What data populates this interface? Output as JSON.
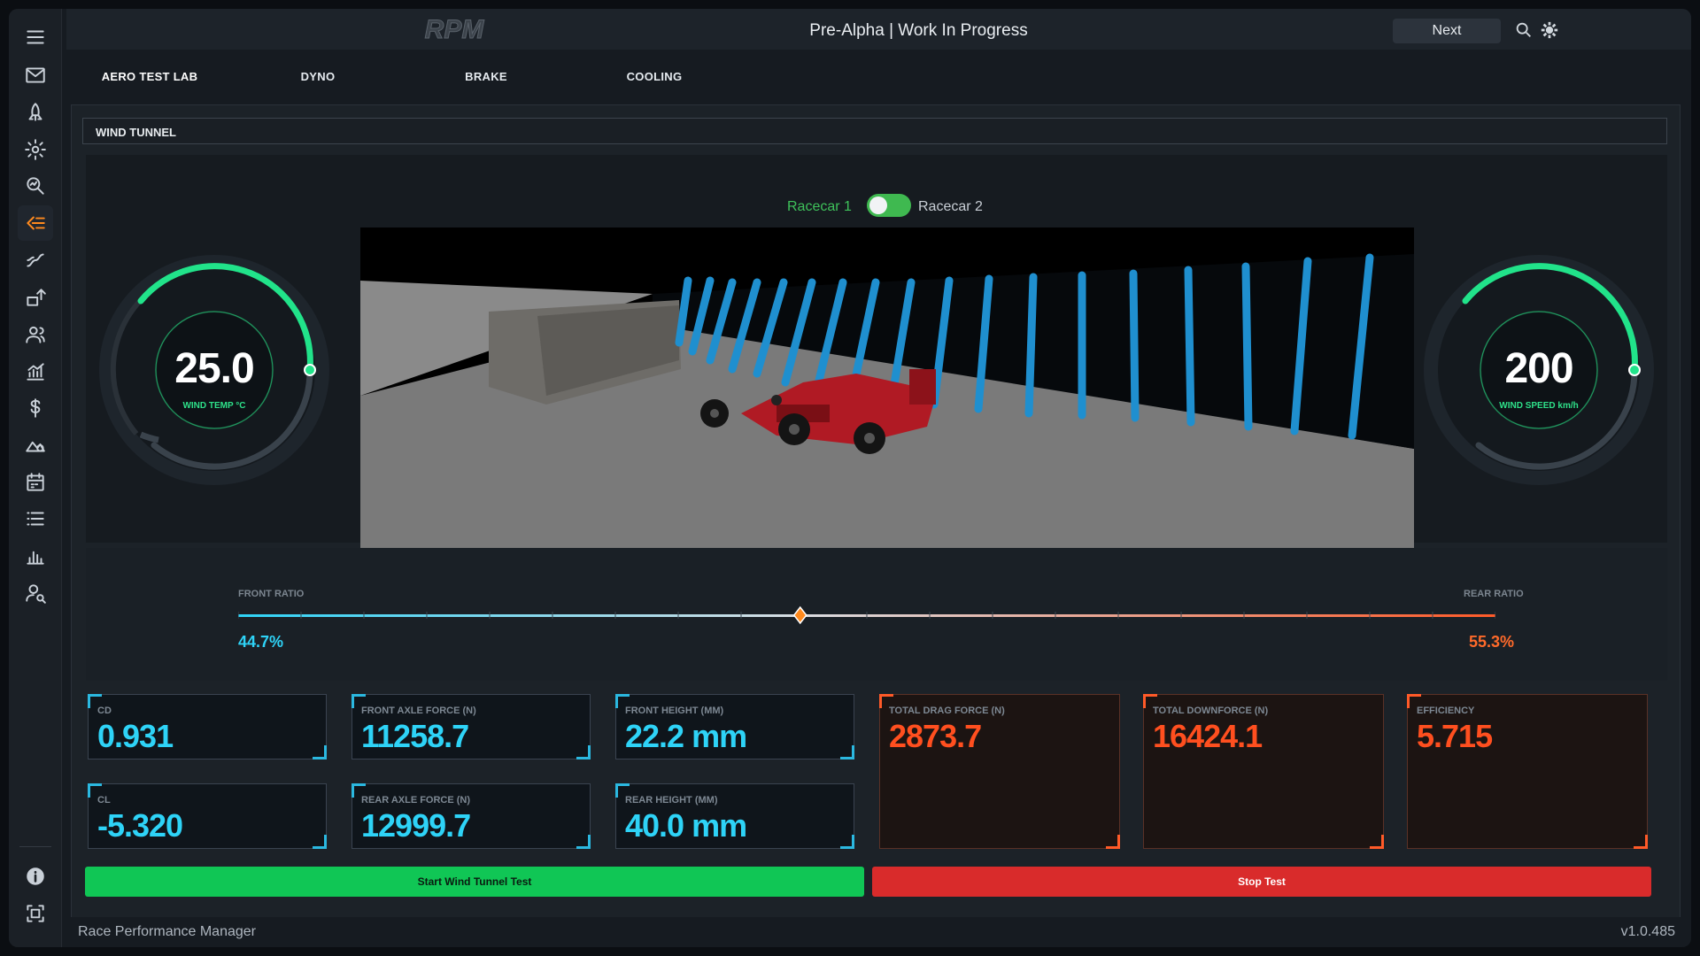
{
  "header": {
    "logo_text": "RPM",
    "title": "Pre-Alpha | Work In Progress",
    "next_label": "Next"
  },
  "sidebar": {
    "items": [
      "menu-icon",
      "mail-icon",
      "rocket-icon",
      "settings-icon",
      "search-analytics-icon",
      "aero-icon",
      "curve-icon",
      "upgrade-icon",
      "staff-icon",
      "chart-icon",
      "dollar-icon",
      "telemetry-icon",
      "calendar-icon",
      "list-icon",
      "standings-icon",
      "scout-icon"
    ],
    "bottom": [
      "info-icon",
      "scan-icon"
    ],
    "active": "aero-icon"
  },
  "tabs": [
    {
      "label": "AERO TEST LAB",
      "active": true
    },
    {
      "label": "DYNO",
      "active": false
    },
    {
      "label": "BRAKE",
      "active": false
    },
    {
      "label": "COOLING",
      "active": false
    }
  ],
  "section": {
    "title": "WIND TUNNEL"
  },
  "toggle": {
    "left_label": "Racecar 1",
    "right_label": "Racecar 2",
    "selected": "Racecar 1"
  },
  "gauges": {
    "wind_temp": {
      "value": "25.0",
      "label": "WIND TEMP °C",
      "level": 0.42
    },
    "wind_speed": {
      "value": "200",
      "label": "WIND SPEED km/h",
      "level": 0.42
    }
  },
  "ratio": {
    "front_label": "FRONT RATIO",
    "rear_label": "REAR RATIO",
    "front_value": "44.7%",
    "rear_value": "55.3%",
    "front_fraction": 0.447
  },
  "metrics": {
    "cd": {
      "label": "CD",
      "value": "0.931"
    },
    "cl": {
      "label": "CL",
      "value": "-5.320"
    },
    "front_axle": {
      "label": "FRONT AXLE FORCE (N)",
      "value": "11258.7"
    },
    "rear_axle": {
      "label": "REAR AXLE FORCE (N)",
      "value": "12999.7"
    },
    "front_height": {
      "label": "FRONT HEIGHT (MM)",
      "value": "22.2 mm"
    },
    "rear_height": {
      "label": "REAR HEIGHT (MM)",
      "value": "40.0 mm"
    },
    "total_drag": {
      "label": "TOTAL DRAG FORCE (N)",
      "value": "2873.7"
    },
    "total_downforce": {
      "label": "TOTAL DOWNFORCE (N)",
      "value": "16424.1"
    },
    "efficiency": {
      "label": "EFFICIENCY",
      "value": "5.715"
    }
  },
  "actions": {
    "start": "Start Wind Tunnel Test",
    "stop": "Stop Test"
  },
  "footer": {
    "app_name": "Race Performance Manager",
    "version": "v1.0.485"
  },
  "colors": {
    "accent_blue": "#1e7fb8",
    "gauge_green": "#21e38a",
    "value_cyan": "#2ed3f7",
    "value_orange": "#ff4f1f",
    "start_green": "#10c655",
    "stop_red": "#d92b2b"
  }
}
